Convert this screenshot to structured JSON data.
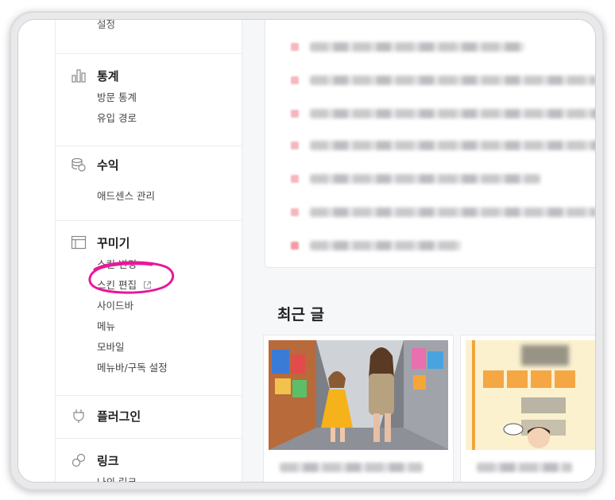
{
  "sidebar": {
    "top_partial": "설정",
    "sections": [
      {
        "title": "통계",
        "icon": "bar-chart-icon",
        "items": [
          "방문 통계",
          "유입 경로"
        ]
      },
      {
        "title": "수익",
        "icon": "coins-icon",
        "items": [
          "애드센스 관리"
        ]
      },
      {
        "title": "꾸미기",
        "icon": "layout-icon",
        "items": [
          "스킨 변경",
          "스킨 편집",
          "사이드바",
          "메뉴",
          "모바일",
          "메뉴바/구독 설정"
        ]
      },
      {
        "title": "플러그인",
        "icon": "plug-icon",
        "items": []
      },
      {
        "title": "링크",
        "icon": "link-icon",
        "items": [
          "나의 링크"
        ]
      }
    ]
  },
  "main": {
    "recent_title": "최근 글"
  },
  "colors": {
    "highlight": "#e8179a",
    "bullet": "#f4b7bd"
  }
}
